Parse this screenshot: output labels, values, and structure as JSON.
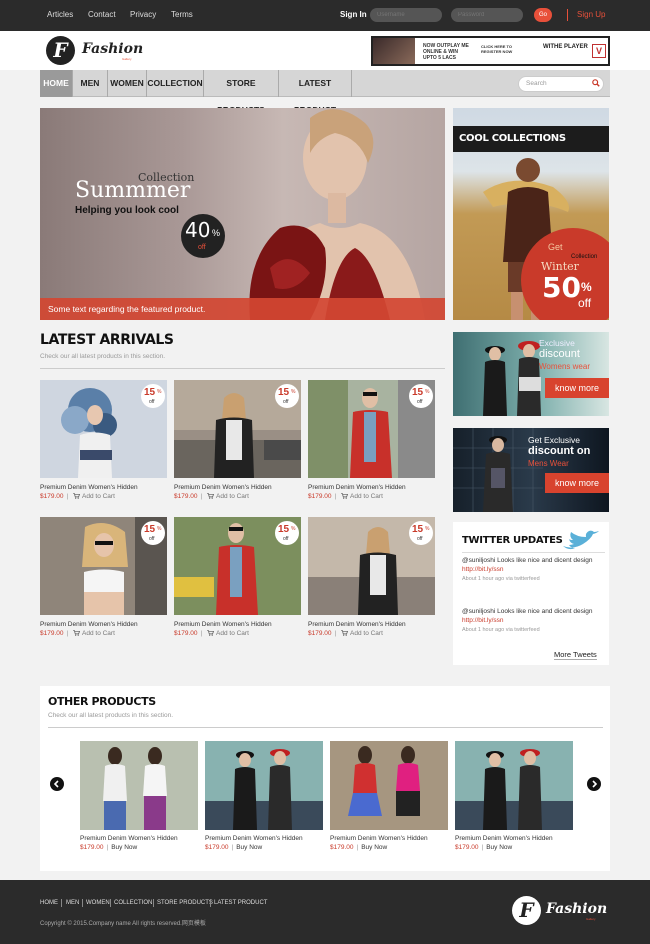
{
  "topbar": {
    "links": [
      "Articles",
      "Contact",
      "Privacy",
      "Terms"
    ],
    "signin_label": "Sign In",
    "username_placeholder": "Username",
    "password_placeholder": "Password",
    "go_label": "Go",
    "signup_label": "Sign Up"
  },
  "header": {
    "logo_letter": "F",
    "logo_text": "Fashion",
    "logo_sub": "Gallery",
    "ad": {
      "line1": "NOW OUTPLAY ME ONLINE & WIN UPTO 5 LACS",
      "line2": "CLICK HERE TO REGISTER NOW",
      "line3": "WITHE PLAYER",
      "badge": "V"
    }
  },
  "nav": {
    "items": [
      "HOME",
      "MEN",
      "WOMEN",
      "COLLECTION",
      "STORE PRODUCTS",
      "LATEST PRODUCT"
    ],
    "search_placeholder": "Search"
  },
  "hero": {
    "collection": "Collection",
    "title": "Summmer",
    "subtitle": "Helping you look cool",
    "discount": "40",
    "discount_pct": "%",
    "discount_off": "off",
    "caption": "Some text regarding the featured product."
  },
  "cool": {
    "title": "COOL COLLECTIONS",
    "get": "Get",
    "collection": "Collection",
    "season": "Winter",
    "discount": "50",
    "pct": "%",
    "off": "off"
  },
  "latest": {
    "title": "LATEST ARRIVALS",
    "subtitle": "Check our all latest products in this section.",
    "products": [
      {
        "name": "Premium Denim Women's Hidden",
        "price": "$179.00",
        "cta": "Add to Cart",
        "badge": "15",
        "badge_pct": "%",
        "badge_off": "off"
      },
      {
        "name": "Premium Denim Women's Hidden",
        "price": "$179.00",
        "cta": "Add to Cart",
        "badge": "15",
        "badge_pct": "%",
        "badge_off": "off"
      },
      {
        "name": "Premium Denim Women's Hidden",
        "price": "$179.00",
        "cta": "Add to Cart",
        "badge": "15",
        "badge_pct": "%",
        "badge_off": "off"
      },
      {
        "name": "Premium Denim Women's Hidden",
        "price": "$179.00",
        "cta": "Add to Cart",
        "badge": "15",
        "badge_pct": "%",
        "badge_off": "off"
      },
      {
        "name": "Premium Denim Women's Hidden",
        "price": "$179.00",
        "cta": "Add to Cart",
        "badge": "15",
        "badge_pct": "%",
        "badge_off": "off"
      },
      {
        "name": "Premium Denim Women's Hidden",
        "price": "$179.00",
        "cta": "Add to Cart",
        "badge": "15",
        "badge_pct": "%",
        "badge_off": "off"
      }
    ]
  },
  "promos": [
    {
      "line1": "Exclusive",
      "line2": "discount",
      "line3": "Womens wear",
      "cta": "know more"
    },
    {
      "line1": "Get Exclusive",
      "line2": "discount on",
      "line3": "Mens Wear",
      "cta": "know more"
    }
  ],
  "twitter": {
    "title": "TWITTER UPDATES",
    "tweets": [
      {
        "text": "@suniljoshi Looks like nice and dicent design",
        "link": "http://bit.ly/ssn",
        "meta": "About 1 hour ago via twitterfeed"
      },
      {
        "text": "@suniljoshi Looks like nice and dicent design",
        "link": "http://bit.ly/ssn",
        "meta": "About 1 hour ago via twitterfeed"
      }
    ],
    "more": "More Tweets"
  },
  "other": {
    "title": "OTHER PRODUCTS",
    "subtitle": "Check our all latest products in this section.",
    "items": [
      {
        "name": "Premium Denim Women's Hidden",
        "price": "$179.00",
        "cta": "Buy Now"
      },
      {
        "name": "Premium Denim Women's Hidden",
        "price": "$179.00",
        "cta": "Buy Now"
      },
      {
        "name": "Premium Denim Women's Hidden",
        "price": "$179.00",
        "cta": "Buy Now"
      },
      {
        "name": "Premium Denim Women's Hidden",
        "price": "$179.00",
        "cta": "Buy Now"
      }
    ]
  },
  "footer": {
    "links": [
      "HOME",
      "MEN",
      "WOMEN",
      "COLLECTION",
      "STORE PRODUCTS",
      "LATEST PRODUCT"
    ],
    "copyright": "Copyright © 2015.Company name All rights reserved.网页模板",
    "logo_letter": "F",
    "logo_text": "Fashion",
    "logo_sub": "Gallery"
  },
  "colors": {
    "accent": "#e8503a",
    "dark": "#2b2b2b",
    "price": "#c93a2a"
  }
}
